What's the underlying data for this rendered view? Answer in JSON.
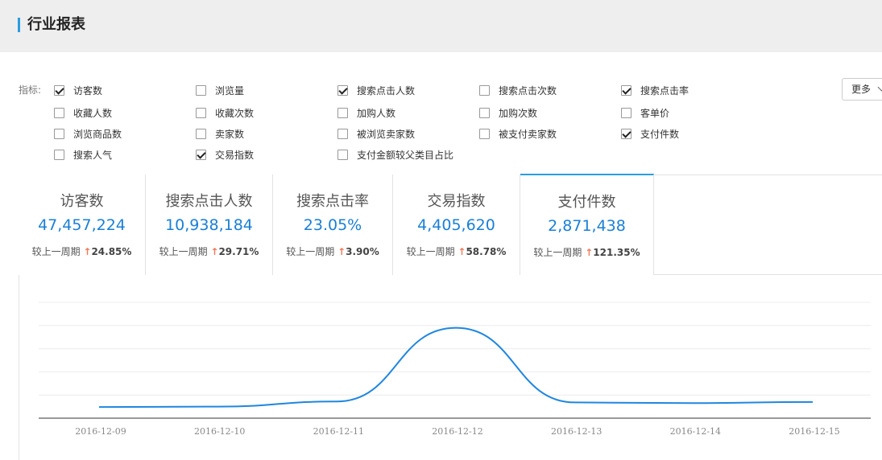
{
  "header": {
    "title": "行业报表"
  },
  "metrics": {
    "label": "指标:",
    "more_label": "更多",
    "options": [
      {
        "label": "访客数",
        "checked": true
      },
      {
        "label": "浏览量",
        "checked": false
      },
      {
        "label": "搜索点击人数",
        "checked": true
      },
      {
        "label": "搜索点击次数",
        "checked": false
      },
      {
        "label": "搜索点击率",
        "checked": true
      },
      {
        "label": "收藏人数",
        "checked": false
      },
      {
        "label": "收藏次数",
        "checked": false
      },
      {
        "label": "加购人数",
        "checked": false
      },
      {
        "label": "加购次数",
        "checked": false
      },
      {
        "label": "客单价",
        "checked": false
      },
      {
        "label": "浏览商品数",
        "checked": false
      },
      {
        "label": "卖家数",
        "checked": false
      },
      {
        "label": "被浏览卖家数",
        "checked": false
      },
      {
        "label": "被支付卖家数",
        "checked": false
      },
      {
        "label": "支付件数",
        "checked": true
      },
      {
        "label": "搜索人气",
        "checked": false
      },
      {
        "label": "交易指数",
        "checked": true
      },
      {
        "label": "支付金额较父类目占比",
        "checked": false
      }
    ]
  },
  "tabs": [
    {
      "name": "访客数",
      "value": "47,457,224",
      "compare_label": "较上一周期",
      "change": "24.85%",
      "active": false
    },
    {
      "name": "搜索点击人数",
      "value": "10,938,184",
      "compare_label": "较上一周期",
      "change": "29.71%",
      "active": false
    },
    {
      "name": "搜索点击率",
      "value": "23.05%",
      "compare_label": "较上一周期",
      "change": "3.90%",
      "active": false
    },
    {
      "name": "交易指数",
      "value": "4,405,620",
      "compare_label": "较上一周期",
      "change": "58.78%",
      "active": false
    },
    {
      "name": "支付件数",
      "value": "2,871,438",
      "compare_label": "较上一周期",
      "change": "121.35%",
      "active": true
    }
  ],
  "colors": {
    "accent": "#2b9de0",
    "line": "#1f86e0",
    "value": "#1a7fd6",
    "up_arrow": "#f07a5a"
  },
  "chart_data": {
    "type": "line",
    "x": [
      "2016-12-09",
      "2016-12-10",
      "2016-12-11",
      "2016-12-12",
      "2016-12-13",
      "2016-12-14",
      "2016-12-15"
    ],
    "values": [
      0.48,
      0.5,
      0.72,
      3.9,
      0.68,
      0.65,
      0.7
    ],
    "ylim": [
      0,
      5
    ],
    "grid": true,
    "y_tick_labels_shown": false
  }
}
